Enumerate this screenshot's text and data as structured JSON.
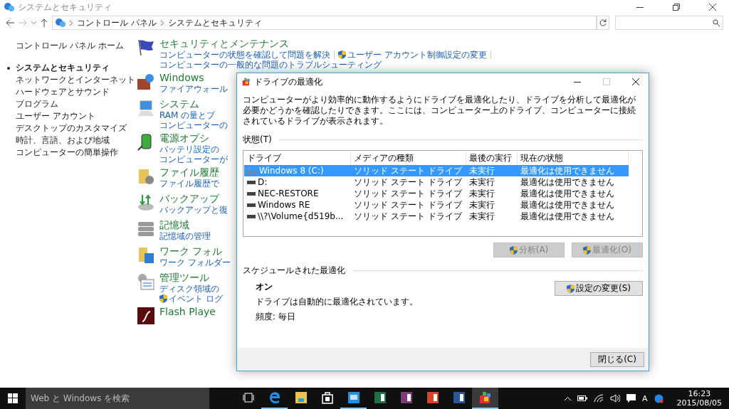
{
  "window": {
    "title": "システムとセキュリティ"
  },
  "address": {
    "breadcrumb": [
      "コントロール パネル",
      "システムとセキュリティ"
    ]
  },
  "sidebar": {
    "home": "コントロール パネル ホーム",
    "items": [
      {
        "label": "システムとセキュリティ",
        "selected": true
      },
      {
        "label": "ネットワークとインターネット",
        "selected": false
      },
      {
        "label": "ハードウェアとサウンド",
        "selected": false
      },
      {
        "label": "プログラム",
        "selected": false
      },
      {
        "label": "ユーザー アカウント",
        "selected": false
      },
      {
        "label": "デスクトップのカスタマイズ",
        "selected": false
      },
      {
        "label": "時計、言語、および地域",
        "selected": false
      },
      {
        "label": "コンピューターの簡単操作",
        "selected": false
      }
    ]
  },
  "categories": [
    {
      "kind": "flag",
      "title": "セキュリティとメンテナンス",
      "links": [
        [
          {
            "text": "コンピューターの状態を確認して問題を解決",
            "shield": false
          },
          {
            "text": "ユーザー アカウント制御設定の変更",
            "shield": true
          }
        ],
        [
          {
            "text": "コンピューターの一般的な問題のトラブルシューティング",
            "shield": false
          }
        ]
      ]
    },
    {
      "kind": "firewall",
      "title": "Windows",
      "links": [
        [
          {
            "text": "ファイアウォール",
            "shield": false
          }
        ]
      ]
    },
    {
      "kind": "monitor",
      "title": "システム",
      "links": [
        [
          {
            "text": "RAM の量とプ",
            "shield": false
          }
        ],
        [
          {
            "text": "コンピューターの",
            "shield": false
          }
        ]
      ]
    },
    {
      "kind": "battery",
      "title": "電源オプシ",
      "links": [
        [
          {
            "text": "バッテリ設定の",
            "shield": false
          }
        ],
        [
          {
            "text": "コンピューターが",
            "shield": false
          }
        ]
      ]
    },
    {
      "kind": "history",
      "title": "ファイル履歴",
      "links": [
        [
          {
            "text": "ファイル履歴で",
            "shield": false
          }
        ]
      ]
    },
    {
      "kind": "backup",
      "title": "バックアップ",
      "links": [
        [
          {
            "text": "バックアップと復",
            "shield": false
          }
        ]
      ]
    },
    {
      "kind": "storage",
      "title": "記憶域",
      "links": [
        [
          {
            "text": "記憶域の管理",
            "shield": false
          }
        ]
      ]
    },
    {
      "kind": "workfolder",
      "title": "ワーク フォル",
      "links": [
        [
          {
            "text": "ワーク フォルダー",
            "shield": false
          }
        ]
      ]
    },
    {
      "kind": "tools",
      "title": "管理ツール",
      "links": [
        [
          {
            "text": "ディスク領域の",
            "shield": false
          }
        ],
        [
          {
            "text": "イベント ログ",
            "shield": true
          }
        ]
      ]
    },
    {
      "kind": "flash",
      "title": "Flash Playe"
    }
  ],
  "dialog": {
    "title": "ドライブの最適化",
    "description": "コンピューターがより効率的に動作するようにドライブを最適化したり、ドライブを分析して最適化が必要かどうかを確認したりできます。ここには、コンピューター上のドライブ、コンピューターに接続されているドライブが表示されます。",
    "status_label": "状態(T)",
    "columns": [
      "ドライブ",
      "メディアの種類",
      "最後の実行",
      "現在の状態"
    ],
    "rows": [
      {
        "kind": "system",
        "drive": "Windows 8 (C:)",
        "media": "ソリッド ステート ドライブ",
        "last_run": "未実行",
        "status": "最適化は使用できません",
        "selected": true
      },
      {
        "kind": "drive",
        "drive": "D:",
        "media": "ソリッド ステート ドライブ",
        "last_run": "未実行",
        "status": "最適化は使用できません",
        "selected": false
      },
      {
        "kind": "drive",
        "drive": "NEC-RESTORE",
        "media": "ソリッド ステート ドライブ",
        "last_run": "未実行",
        "status": "最適化は使用できません",
        "selected": false
      },
      {
        "kind": "drive",
        "drive": "Windows RE",
        "media": "ソリッド ステート ドライブ",
        "last_run": "未実行",
        "status": "最適化は使用できません",
        "selected": false
      },
      {
        "kind": "drive",
        "drive": "\\\\?\\Volume{d519b...",
        "media": "ソリッド ステート ドライブ",
        "last_run": "未実行",
        "status": "最適化は使用できません",
        "selected": false
      }
    ],
    "actions": [
      {
        "label": "分析(A)",
        "disabled": true
      },
      {
        "label": "最適化(O)",
        "disabled": true
      }
    ],
    "schedule": {
      "label": "スケジュールされた最適化",
      "state": "オン",
      "description": "ドライブは自動的に最適化されています。",
      "frequency": "頻度: 毎日",
      "button": "設定の変更(S)"
    },
    "close": "閉じる(C)"
  },
  "taskbar": {
    "search": {
      "placeholder": "Web と Windows を検索"
    },
    "apps": [
      {
        "kind": "taskview",
        "running": false,
        "selected": false
      },
      {
        "kind": "edge",
        "running": true,
        "selected": false
      },
      {
        "kind": "explorer",
        "running": false,
        "selected": false
      },
      {
        "kind": "store",
        "running": false,
        "selected": false
      },
      {
        "kind": "remote",
        "running": true,
        "selected": false
      },
      {
        "kind": "excel",
        "running": false,
        "selected": false
      },
      {
        "kind": "onenote",
        "running": false,
        "selected": false
      },
      {
        "kind": "powerpoint",
        "running": false,
        "selected": false
      },
      {
        "kind": "word",
        "running": false,
        "selected": false
      },
      {
        "kind": "defrag",
        "running": true,
        "selected": true
      }
    ],
    "ime": "A",
    "time": "16:23",
    "date": "2015/08/05"
  }
}
